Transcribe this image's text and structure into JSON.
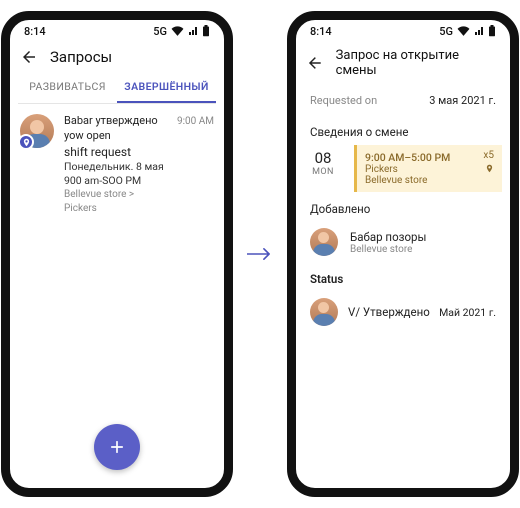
{
  "time": "8:14",
  "network": "5G",
  "left": {
    "header": "Запросы",
    "tabs": {
      "develop": "РАЗВИВАТЬСЯ",
      "completed": "ЗАВЕРШЁННЫЙ"
    },
    "item": {
      "line1": "Babar утверждено yow open",
      "line2": "shift request",
      "line3": "Понедельник. 8 мая 900 am-SOO PM",
      "line4": "Bellevue store > Pickers",
      "time": "9:00 AM"
    }
  },
  "right": {
    "header": "Запрос на открытие смены",
    "requested_lbl": "Requested on",
    "requested_val": "3 мая 2021 г.",
    "shift_section": "Сведения о смене",
    "shift": {
      "day": "08",
      "weekday": "MON",
      "time": "9:00 AM–5:00 PM",
      "group": "Pickers",
      "store": "Bellevue store",
      "count": "x5"
    },
    "added_section": "Добавлено",
    "added": {
      "name": "Бабар позоры",
      "sub": "Bellevue store"
    },
    "status_section": "Status",
    "status": {
      "text": "V/ Утверждено",
      "date": "Май 2021 г."
    }
  }
}
